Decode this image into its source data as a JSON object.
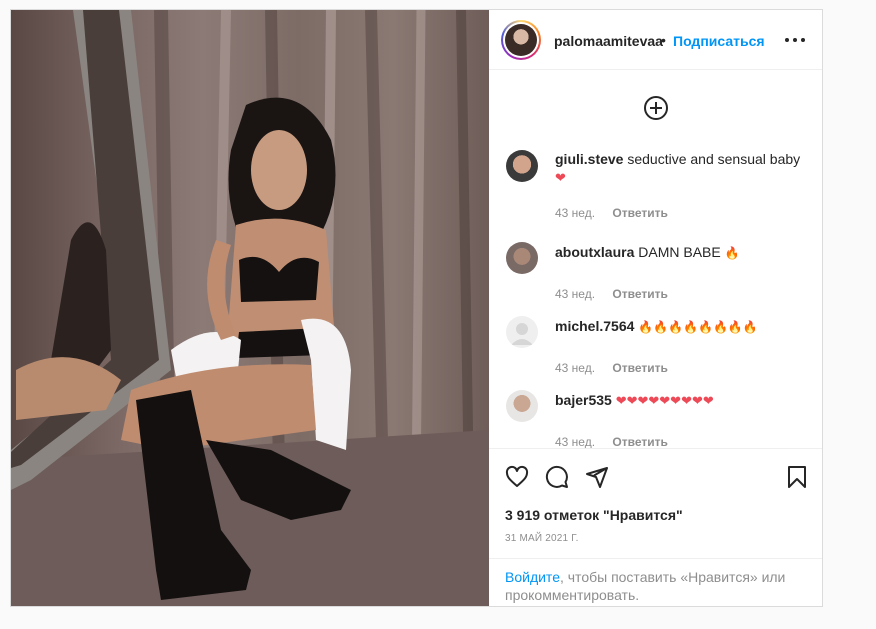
{
  "post": {
    "username": "palomaamitevaa",
    "separator": "•",
    "follow_label": "Подписаться"
  },
  "comments": [
    {
      "user": "giuli.steve",
      "text": "seductive and sensual baby",
      "emoji": "❤",
      "time": "43 нед.",
      "reply": "Ответить"
    },
    {
      "user": "aboutxlaura",
      "text": "DAMN BABE",
      "emoji": "🔥",
      "time": "43 нед.",
      "reply": "Ответить"
    },
    {
      "user": "michel.7564",
      "text": "",
      "emoji": "🔥🔥🔥🔥🔥🔥🔥🔥",
      "time": "43 нед.",
      "reply": "Ответить"
    },
    {
      "user": "bajer535",
      "text": "",
      "emoji": "❤❤❤❤❤❤❤❤❤",
      "time": "43 нед.",
      "reply": "Ответить"
    }
  ],
  "stats": {
    "likes": "3 919 отметок \"Нравится\"",
    "date": "31 МАЙ 2021 Г."
  },
  "login_prompt": {
    "link": "Войдите",
    "rest": ", чтобы поставить «Нравится» или прокомментировать."
  },
  "icons": {
    "more": "more-icon",
    "add": "plus-circle-icon",
    "like": "heart-icon",
    "comment": "comment-icon",
    "share": "share-icon",
    "save": "bookmark-icon"
  },
  "colors": {
    "accent": "#0095f6",
    "heart": "#ed4956"
  }
}
